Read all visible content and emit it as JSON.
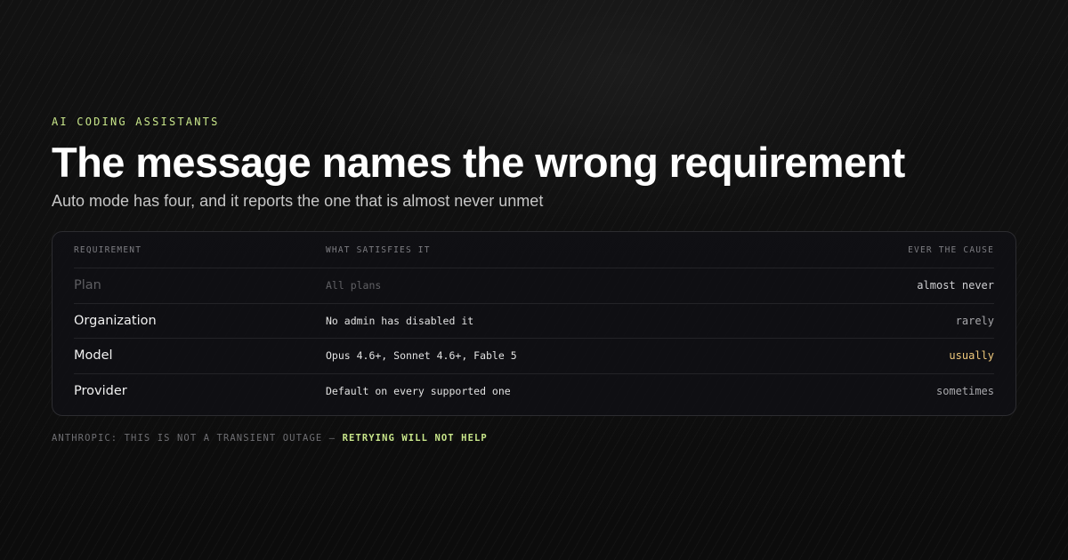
{
  "header": {
    "eyebrow": "AI CODING ASSISTANTS",
    "title": "The message names the wrong requirement",
    "subtitle": "Auto mode has four, and it reports the one that is almost never unmet"
  },
  "table": {
    "columns": [
      "REQUIREMENT",
      "WHAT SATISFIES IT",
      "EVER THE CAUSE"
    ],
    "rows": [
      {
        "requirement": "Plan",
        "satisfies": "All plans",
        "cause": "almost never"
      },
      {
        "requirement": "Organization",
        "satisfies": "No admin has disabled it",
        "cause": "rarely"
      },
      {
        "requirement": "Model",
        "satisfies": "Opus 4.6+, Sonnet 4.6+, Fable 5",
        "cause": "usually"
      },
      {
        "requirement": "Provider",
        "satisfies": "Default on every supported one",
        "cause": "sometimes"
      }
    ]
  },
  "footer": {
    "prefix": "ANTHROPIC: THIS IS NOT A TRANSIENT OUTAGE —",
    "emphasis": "RETRYING WILL NOT HELP"
  },
  "colors": {
    "accent_green": "#c8e68a",
    "highlight_amber": "#f0c97c",
    "background": "#0e0e0e"
  }
}
